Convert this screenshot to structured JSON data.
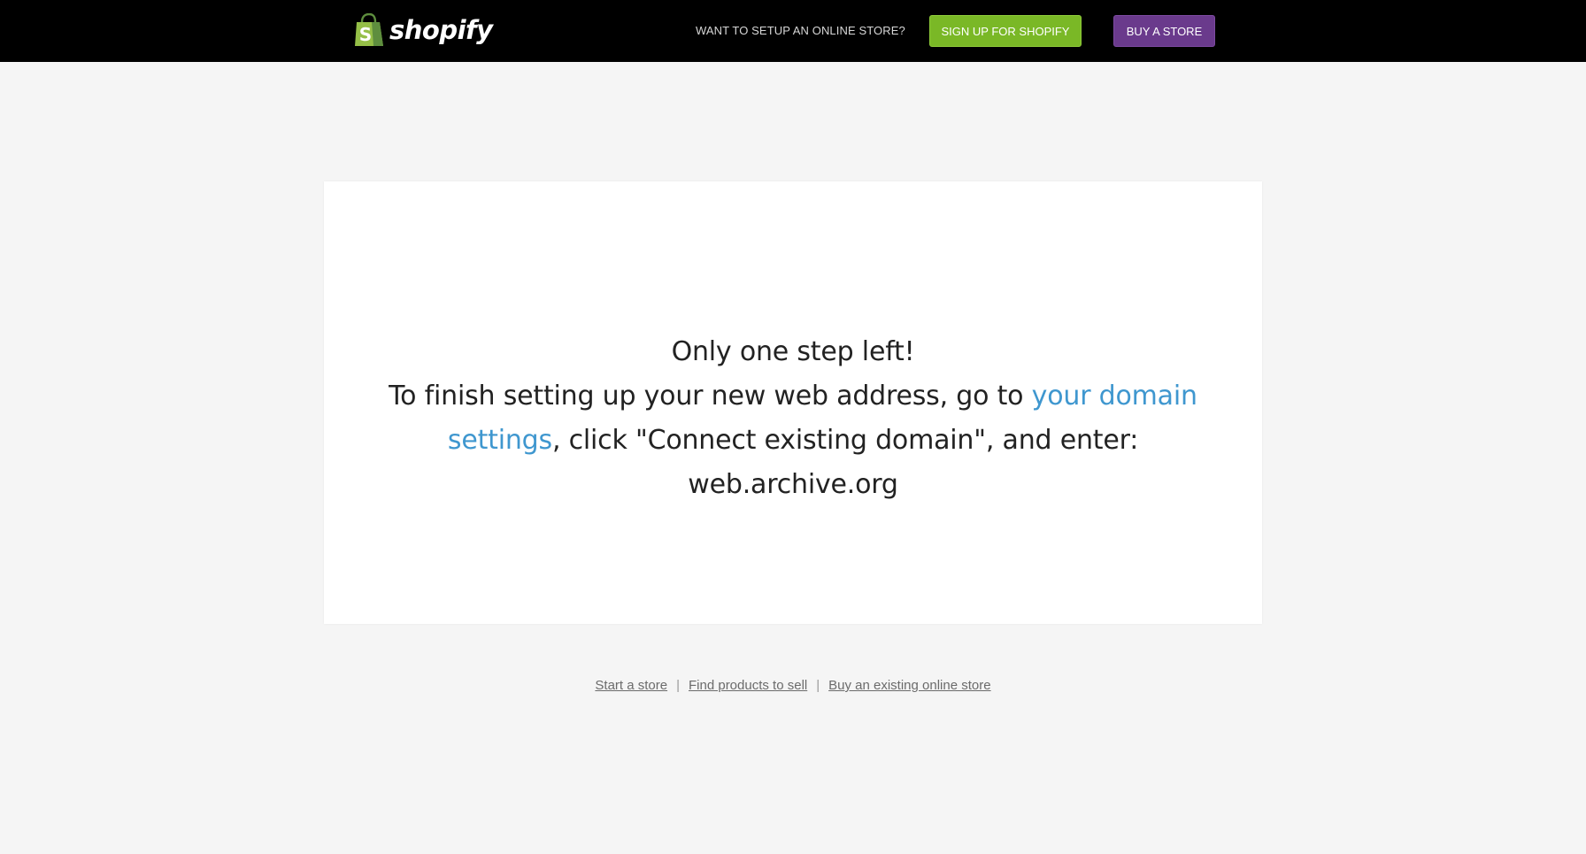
{
  "header": {
    "brand": "shopify",
    "prompt": "WANT TO SETUP AN ONLINE STORE?",
    "signup_label": "SIGN UP FOR SHOPIFY",
    "buy_label": "BUY A STORE"
  },
  "main": {
    "headline": "Only one step left!",
    "instruction_before": "To finish setting up your new web address, go to ",
    "link_label": "your domain settings",
    "instruction_after": ", click \"Connect existing domain\", and enter: web.archive.org"
  },
  "footer": {
    "links": [
      {
        "label": "Start a store"
      },
      {
        "label": "Find products to sell"
      },
      {
        "label": "Buy an existing online store"
      }
    ],
    "separator": "|"
  },
  "colors": {
    "topbar": "#000000",
    "signup": "#7ab826",
    "buy": "#6a3a8c",
    "link": "#3f97cf",
    "page_bg": "#f5f5f5"
  }
}
